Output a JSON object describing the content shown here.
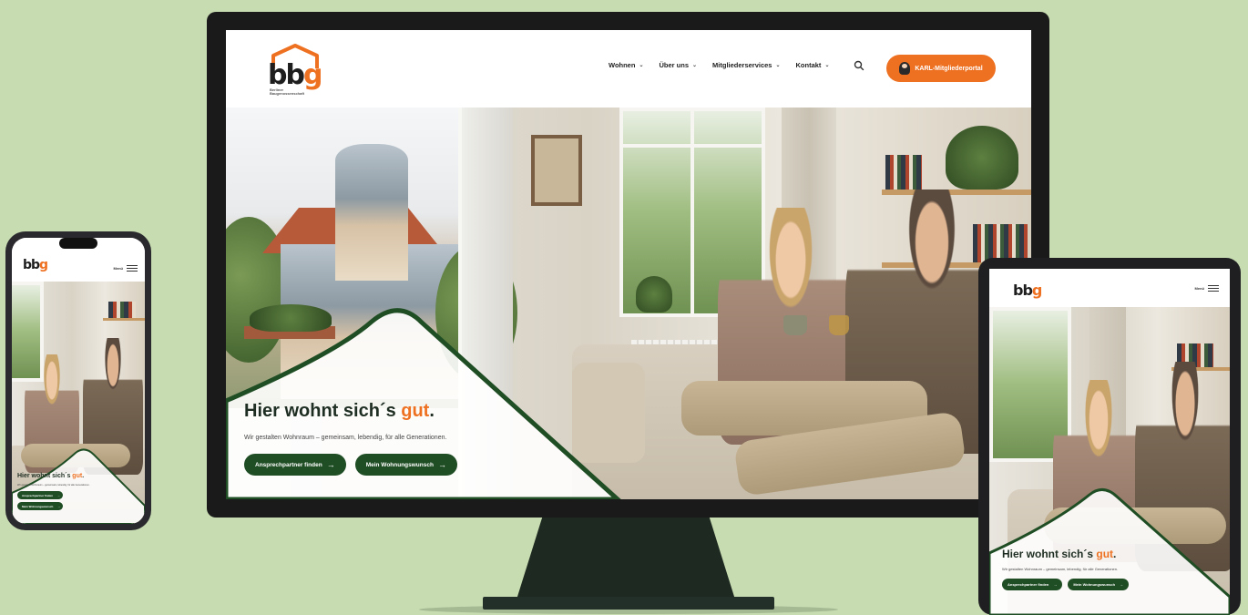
{
  "site": {
    "logo_text_main": "bb",
    "logo_text_accent": "g",
    "logo_subtext": "Berliner Baugenossenschaft",
    "brand_orange": "#ee7122",
    "brand_green": "#1f4d24"
  },
  "nav": {
    "items": [
      {
        "label": "Wohnen",
        "icon": "chevron-down-icon"
      },
      {
        "label": "Über uns",
        "icon": "chevron-down-icon"
      },
      {
        "label": "Mitgliederservices",
        "icon": "chevron-down-icon"
      },
      {
        "label": "Kontakt",
        "icon": "chevron-down-icon"
      }
    ],
    "search_icon": "search-icon",
    "cta_label": "KARL-Mitgliederportal",
    "mobile_menu_label": "Menü"
  },
  "hero": {
    "headline_main": "Hier wohnt sich´s ",
    "headline_accent": "gut",
    "headline_end": ".",
    "subline": "Wir gestalten Wohnraum – gemeinsam, lebendig, für alle Generationen.",
    "button_primary": "Ansprechpartner finden",
    "button_secondary": "Mein Wohnungswunsch",
    "arrow": "→"
  }
}
